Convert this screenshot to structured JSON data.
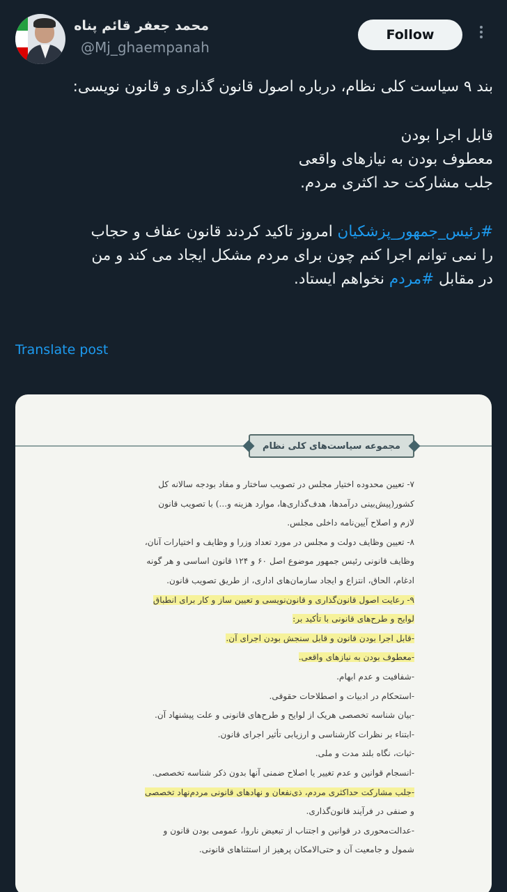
{
  "author": {
    "name": "محمد جعفر قائم پناه",
    "handle": "@Mj_ghaempanah",
    "follow_label": "Follow"
  },
  "tweet": {
    "line1": "بند ۹ سیاست کلی نظام، درباره اصول قانون گذاری و قانون نویسی:",
    "line2": "قابل اجرا بودن",
    "line3": "معطوف بودن به نیازهای واقعی",
    "line4": "جلب مشارکت حد اکثری مردم.",
    "hashtag1": "#رئیس_جمهور_پزشکیان",
    "line5_rest": " امروز تاکید کردند قانون عفاف و حجاب",
    "line6": "را نمی توانم اجرا کنم چون  برای مردم مشکل ایجاد می کند و من",
    "line7_pre": "در مقابل ",
    "hashtag2": "#مردم",
    "line7_post": " نخواهم ایستاد."
  },
  "translate_label": "Translate post",
  "document": {
    "banner": "مجموعه سیاست‌های کلی نظام",
    "lines": [
      "۷- تعیین محدوده اختیار مجلس در تصویب ساختار و مفاد بودجه سالانه کل",
      "کشور(پیش‌بینی درآمدها، هدف‌گذاری‌ها، موارد هزینه و...) با تصویب قانون",
      "لازم و اصلاح آیین‌نامه داخلی مجلس.",
      "۸- تعیین وظایف دولت و مجلس در مورد تعداد وزرا و وظایف و اختیارات آنان،",
      "وظایف قانونی رئیس جمهور موضوع اصل ۶۰ و ۱۲۴ قانون اساسی و هر گونه",
      "ادغام، الحاق، انتزاع و ایجاد سازمان‌های اداری، از طریق تصویب قانون.",
      "۹- رعایت اصول قانون‌گذاری و قانون‌نویسی و تعیین ساز و کار برای انطباق",
      "لوایح و طرح‌های قانونی با تأکید بر:",
      "-قابل اجرا بودن قانون و قابل سنجش بودن اجرای آن.",
      "-معطوف بودن به نیازهای واقعی.",
      "-شفافیت و عدم ابهام.",
      "-استحکام در ادبیات و اصطلاحات حقوقی.",
      "-بیان شناسه تخصصی هریک از لوایح و طرح‌های قانونی و علت پیشنهاد آن.",
      "-ابتناء بر نظرات کارشناسی و ارزیابی تأثیر اجرای قانون.",
      "-ثبات، نگاه بلند مدت و ملی.",
      "-انسجام قوانین و عدم تغییر یا اصلاح ضمنی آنها بدون ذکر شناسه تخصصی.",
      "-جلب مشارکت حداکثری مردم، ذی‌نفعان و نهادهای قانونی مردم‌نهاد تخصصی",
      "و صنفی در فرآیند قانون‌گذاری.",
      "-عدالت‌محوری در قوانین و اجتناب از تبعیض ناروا، عمومی بودن قانون و",
      "شمول و جامعیت آن و حتی‌الامکان پرهیز از استثناهای قانونی."
    ]
  },
  "colors": {
    "background": "#15202b",
    "link": "#1d9bf0",
    "highlight": "#f6f29a"
  }
}
